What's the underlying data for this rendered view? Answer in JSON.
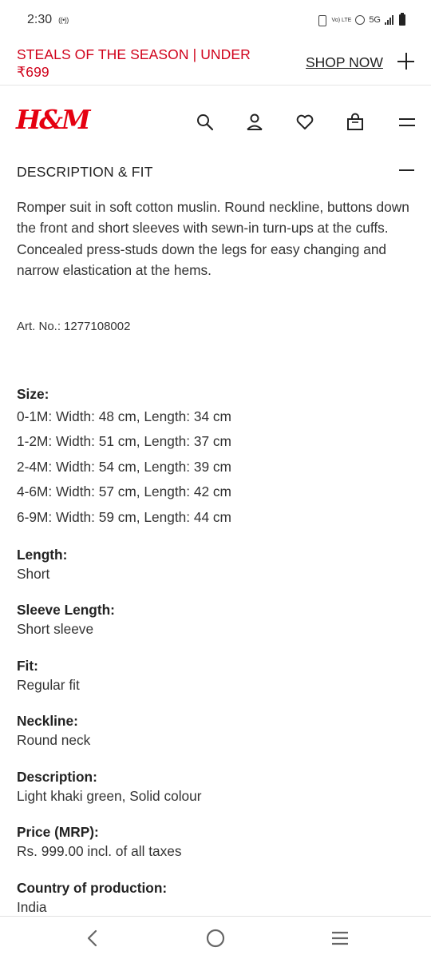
{
  "status_bar": {
    "time": "2:30",
    "radio_glyph": "((•))",
    "volte": "Vo) LTE",
    "network": "5G",
    "icons": [
      "vibrate-icon",
      "hotspot-icon",
      "signal-icon",
      "battery-icon"
    ]
  },
  "promo": {
    "text": "STEALS OF THE SEASON | UNDER ₹699",
    "link_label": "SHOP NOW",
    "text_color": "#d0021b"
  },
  "header": {
    "logo_text": "H&M",
    "brand_color": "#e50010",
    "icons": [
      "search-icon",
      "account-icon",
      "favorites-icon",
      "shopping-bag-icon",
      "menu-icon"
    ]
  },
  "section": {
    "title": "DESCRIPTION & FIT",
    "description": "Romper suit in soft cotton muslin. Round neckline, buttons down the front and short sleeves with sewn-in turn-ups at the cuffs. Concealed press-studs down the legs for easy changing and narrow elastication at the hems.",
    "art_no_label": "Art. No.:",
    "art_no_value": "1277108002"
  },
  "size": {
    "label": "Size:",
    "rows": [
      "0-1M: Width: 48 cm, Length: 34 cm",
      "1-2M: Width: 51 cm, Length: 37 cm",
      "2-4M: Width: 54 cm, Length: 39 cm",
      "4-6M: Width: 57 cm, Length: 42 cm",
      "6-9M: Width: 59 cm, Length: 44 cm"
    ]
  },
  "attributes": [
    {
      "label": "Length:",
      "value": "Short"
    },
    {
      "label": "Sleeve Length:",
      "value": "Short sleeve"
    },
    {
      "label": "Fit:",
      "value": "Regular fit"
    },
    {
      "label": "Neckline:",
      "value": "Round neck"
    },
    {
      "label": "Description:",
      "value": "Light khaki green, Solid colour"
    },
    {
      "label": "Price (MRP):",
      "value": "Rs. 999.00 incl. of all taxes"
    },
    {
      "label": "Country of production:",
      "value": "India"
    }
  ],
  "navbar": {
    "icons": [
      "back-icon",
      "home-icon",
      "recents-icon"
    ]
  }
}
